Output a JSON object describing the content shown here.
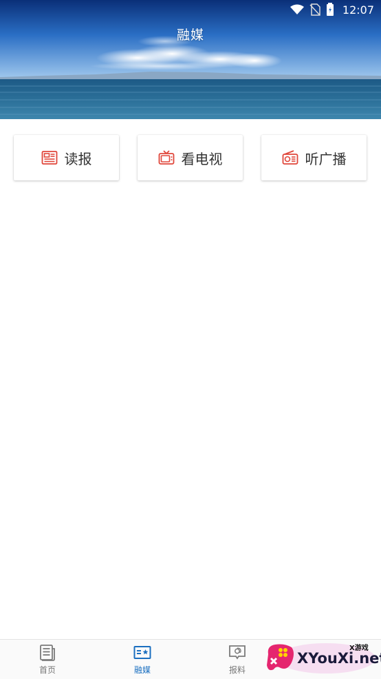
{
  "status_bar": {
    "time": "12:07"
  },
  "header": {
    "title": "融媒"
  },
  "media_buttons": [
    {
      "label": "读报",
      "icon": "newspaper-icon"
    },
    {
      "label": "看电视",
      "icon": "tv-icon"
    },
    {
      "label": "听广播",
      "icon": "radio-icon"
    }
  ],
  "bottom_nav": [
    {
      "label": "首页",
      "icon": "document-icon",
      "active": false
    },
    {
      "label": "融媒",
      "icon": "media-card-icon",
      "active": true
    },
    {
      "label": "报料",
      "icon": "report-chat-icon",
      "active": false
    },
    {
      "label": "",
      "icon": "profile-icon",
      "active": false
    }
  ],
  "watermark": {
    "big": "XYouXi.net",
    "small": "X游戏"
  },
  "colors": {
    "accent_red": "#e0463a",
    "active_blue": "#1a6fc0",
    "nav_grey": "#777777",
    "sky_top": "#0b3d8c",
    "sea": "#1f5f8a"
  }
}
